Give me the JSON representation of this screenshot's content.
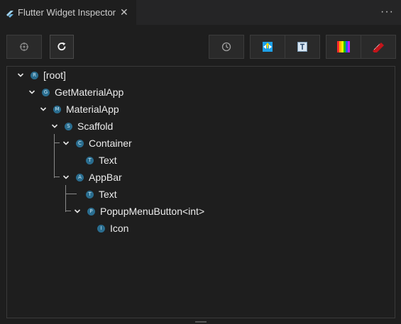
{
  "tab": {
    "title": "Flutter Widget Inspector",
    "close": "✕"
  },
  "more": "···",
  "toolbar": {
    "select_widget": "select-widget-mode",
    "refresh": "refresh-tree",
    "history": "history",
    "debug_paint": "debug-paint",
    "text_baselines": "paint-baselines",
    "repaint_rainbow": "repaint-rainbow",
    "debug_banner": "debug-banner"
  },
  "tree": [
    {
      "label": "[root]",
      "badge": "R"
    },
    {
      "label": "GetMaterialApp",
      "badge": "G"
    },
    {
      "label": "MaterialApp",
      "badge": "M"
    },
    {
      "label": "Scaffold",
      "badge": "S"
    },
    {
      "label": "Container",
      "badge": "C"
    },
    {
      "label": "Text",
      "badge": "T"
    },
    {
      "label": "AppBar",
      "badge": "A"
    },
    {
      "label": "Text",
      "badge": "T"
    },
    {
      "label": "PopupMenuButton<int>",
      "badge": "P"
    },
    {
      "label": "Icon",
      "badge": "I"
    }
  ]
}
